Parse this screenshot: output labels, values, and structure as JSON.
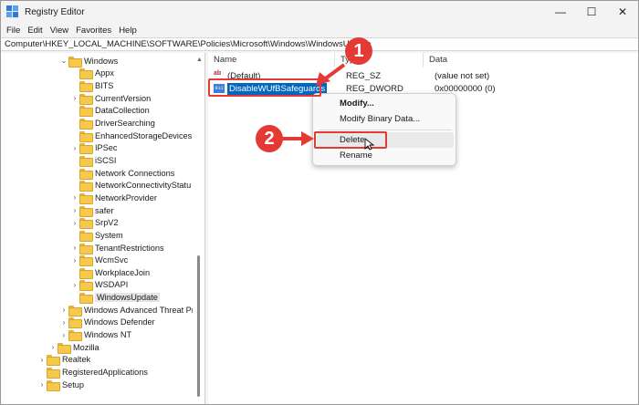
{
  "window": {
    "title": "Registry Editor",
    "controls": {
      "minimize": "—",
      "maximize": "☐",
      "close": "✕"
    }
  },
  "menu": [
    "File",
    "Edit",
    "View",
    "Favorites",
    "Help"
  ],
  "address": "Computer\\HKEY_LOCAL_MACHINE\\SOFTWARE\\Policies\\Microsoft\\Windows\\WindowsUpdate",
  "tree": [
    {
      "label": "Windows",
      "chev": "v"
    },
    {
      "label": "Appx"
    },
    {
      "label": "BITS"
    },
    {
      "label": "CurrentVersion",
      "chev": ">"
    },
    {
      "label": "DataCollection"
    },
    {
      "label": "DriverSearching"
    },
    {
      "label": "EnhancedStorageDevices"
    },
    {
      "label": "IPSec",
      "chev": ">"
    },
    {
      "label": "iSCSI"
    },
    {
      "label": "Network Connections"
    },
    {
      "label": "NetworkConnectivityStatu"
    },
    {
      "label": "NetworkProvider",
      "chev": ">"
    },
    {
      "label": "safer",
      "chev": ">"
    },
    {
      "label": "SrpV2",
      "chev": ">"
    },
    {
      "label": "System"
    },
    {
      "label": "TenantRestrictions",
      "chev": ">"
    },
    {
      "label": "WcmSvc",
      "chev": ">"
    },
    {
      "label": "WorkplaceJoin"
    },
    {
      "label": "WSDAPI",
      "chev": ">"
    },
    {
      "label": "WindowsUpdate",
      "selected": true
    },
    {
      "label": "Windows Advanced Threat Pr",
      "chev": ">"
    },
    {
      "label": "Windows Defender",
      "chev": ">"
    },
    {
      "label": "Windows NT",
      "chev": ">"
    },
    {
      "label": "Mozilla",
      "chev": ">"
    },
    {
      "label": "Realtek",
      "chev": ">"
    },
    {
      "label": "RegisteredApplications"
    },
    {
      "label": "Setup",
      "chev": ">"
    }
  ],
  "columns": {
    "name": "Name",
    "type": "Type",
    "data": "Data"
  },
  "values": [
    {
      "icon": "ab",
      "name": "(Default)",
      "type": "REG_SZ",
      "data": "(value not set)"
    },
    {
      "icon": "bin",
      "name": "DisableWUfBSafeguards",
      "type": "REG_DWORD",
      "data": "0x00000000 (0)"
    }
  ],
  "context_menu": [
    "Modify...",
    "Modify Binary Data...",
    "Delete",
    "Rename"
  ],
  "callouts": [
    "1",
    "2"
  ],
  "colors": {
    "accent": "#0067c0",
    "callout": "#e53935",
    "folder": "#f6c84c"
  }
}
